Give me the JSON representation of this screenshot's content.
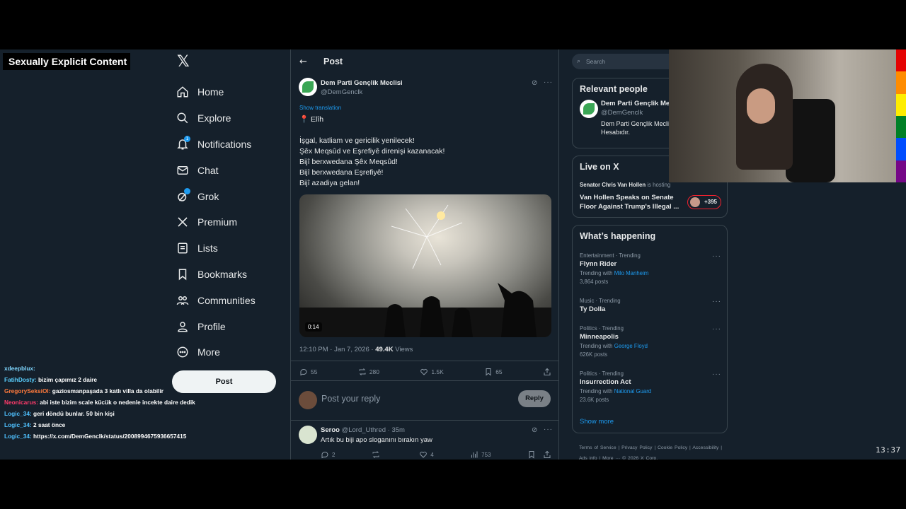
{
  "overlay": {
    "tag": "Sexually Explicit Content"
  },
  "nav": {
    "items": [
      {
        "label": "Home",
        "icon": "home-icon"
      },
      {
        "label": "Explore",
        "icon": "search-icon"
      },
      {
        "label": "Notifications",
        "icon": "bell-icon"
      },
      {
        "label": "Chat",
        "icon": "mail-icon"
      },
      {
        "label": "Grok",
        "icon": "grok-icon"
      },
      {
        "label": "Premium",
        "icon": "x-icon"
      },
      {
        "label": "Lists",
        "icon": "list-icon"
      },
      {
        "label": "Bookmarks",
        "icon": "bookmark-icon"
      },
      {
        "label": "Communities",
        "icon": "communities-icon"
      },
      {
        "label": "Profile",
        "icon": "person-icon"
      },
      {
        "label": "More",
        "icon": "more-icon"
      }
    ],
    "post_button": "Post"
  },
  "chat": [
    {
      "user": "xdeepblux:",
      "text": "",
      "color": "#7fd7ff"
    },
    {
      "user": "FatihDosty:",
      "text": "bizim çapımız 2 daire",
      "color": "#5ad0ff"
    },
    {
      "user": "GregorySeksiOl:",
      "text": "gaziosmanpaşada 3 katlı villa da olabilir",
      "color": "#ff7a3c"
    },
    {
      "user": "Neonicarus:",
      "text": "abi iste bizim scale kücük o nedenle incekte daire dedik",
      "color": "#ff3b6b"
    },
    {
      "user": "Logic_34:",
      "text": "geri döndü bunlar. 50 bin kişi",
      "color": "#4fc1ff"
    },
    {
      "user": "Logic_34:",
      "text": "2 saat önce",
      "color": "#4fc1ff"
    },
    {
      "user": "Logic_34:",
      "text": "https://x.com/DemGenclk/status/2008994675936657415",
      "color": "#4fc1ff"
    }
  ],
  "post": {
    "header_title": "Post",
    "author_name": "Dem Parti Gençlik Meclisi",
    "author_handle": "@DemGenclk",
    "show_translation": "Show translation",
    "lines": [
      "📍 Elîh",
      "",
      "İşgal, katliam ve gericilik yenilecek!",
      "Şêx Meqsûd ve Eşrefiyê direnişi kazanacak!",
      "Bijî berxwedana Şêx Meqsûd!",
      "Bijî berxwedana Eşrefiyê!",
      "Bijî azadiya gelan!"
    ],
    "video_duration": "0:14",
    "time": "12:10 PM · Jan 7, 2026 · ",
    "views_count": "49.4K",
    "views_label": " Views",
    "stats": {
      "replies": "55",
      "reposts": "280",
      "likes": "1.5K",
      "bookmarks": "65"
    },
    "reply_placeholder": "Post your reply",
    "reply_button": "Reply"
  },
  "reply": {
    "name": "Seroo",
    "handle_time": " @Lord_Uthred · 35m",
    "text": "Artık bu biji apo sloganını bırakın yaw",
    "stats": {
      "replies": "2",
      "reposts": "",
      "likes": "4",
      "views": "753"
    }
  },
  "sidebar": {
    "search_placeholder": "Search",
    "relevant_title": "Relevant people",
    "relevant_name": "Dem Parti Gençlik Meclisi",
    "relevant_handle": "@DemGenclk",
    "relevant_bio": "Dem Parti Gençlik Meclisi Resmi Hesabıdır.",
    "live_title": "Live on X",
    "live_host": "Senator Chris Van Hollen",
    "live_hosting": " is hosting",
    "live_stream": "Van Hollen Speaks on Senate Floor Against Trump's Illegal ...",
    "live_count": "+395",
    "happening_title": "What’s happening",
    "trends": [
      {
        "category": "Entertainment · Trending",
        "name": "Flynn Rider",
        "with_label": "Trending with ",
        "with": "Milo Manheim",
        "posts": "3,864 posts"
      },
      {
        "category": "Music · Trending",
        "name": "Ty Dolla",
        "with_label": "",
        "with": "",
        "posts": ""
      },
      {
        "category": "Politics · Trending",
        "name": "Minneapolis",
        "with_label": "Trending with ",
        "with": "George Floyd",
        "posts": "626K posts"
      },
      {
        "category": "Politics · Trending",
        "name": "Insurrection Act",
        "with_label": "Trending with ",
        "with": "National Guard",
        "posts": "23.6K posts"
      }
    ],
    "show_more": "Show more",
    "footer": "Terms of Service  |  Privacy Policy  |  Cookie Policy  |  Accessibility  |  Ads info  |  More ···  © 2026 X Corp."
  },
  "clock": "13:37",
  "colors": {
    "accent": "#1d9bf0",
    "background": "#15202b",
    "border": "#38444d"
  }
}
